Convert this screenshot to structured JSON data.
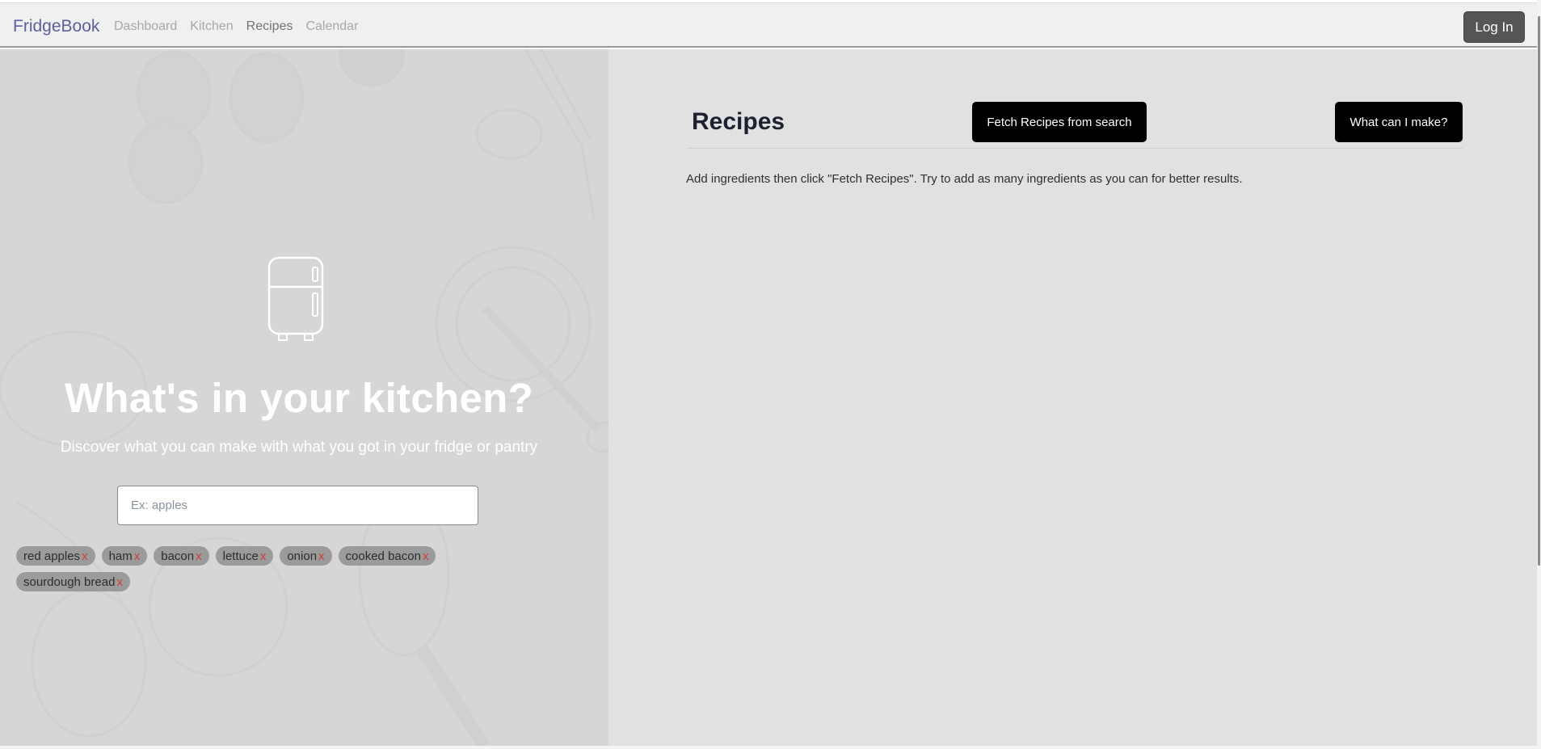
{
  "navbar": {
    "brand": "FridgeBook",
    "links": [
      {
        "label": "Dashboard",
        "active": false
      },
      {
        "label": "Kitchen",
        "active": false
      },
      {
        "label": "Recipes",
        "active": true
      },
      {
        "label": "Calendar",
        "active": false
      }
    ],
    "login_label": "Log In"
  },
  "hero": {
    "icon": "fridge-icon",
    "title": "What's in your kitchen?",
    "subtitle": "Discover what you can make with what you got in your fridge or pantry",
    "search_placeholder": "Ex: apples",
    "search_value": "",
    "remove_symbol": "x",
    "ingredients": [
      "red apples",
      "ham",
      "bacon",
      "lettuce",
      "onion",
      "cooked bacon",
      "sourdough bread"
    ]
  },
  "recipes": {
    "title": "Recipes",
    "fetch_button": "Fetch Recipes from search",
    "make_button": "What can I make?",
    "helper_text": "Add ingredients then click \"Fetch Recipes\". Try to add as many ingredients as you can for better results."
  },
  "colors": {
    "brand": "#5d5f9e",
    "panel_bg": "#e1e1e1",
    "tag_bg": "#9b9b9b",
    "tag_remove": "#d43b3b",
    "button_bg": "#000000"
  }
}
